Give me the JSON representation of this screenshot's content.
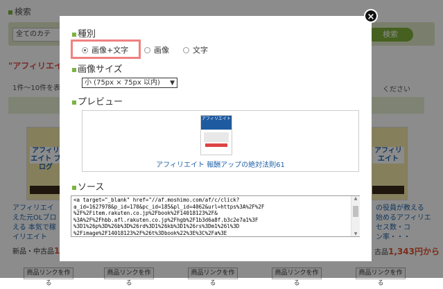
{
  "background": {
    "search_label": "検索",
    "category_select": "全てのカテ",
    "search_button": "検索",
    "heading": "\"アフィリエイ",
    "count": "1件〜10件を表",
    "right_note": "ください",
    "books": [
      {
        "title": "アフィリエイト\nブログ"
      },
      {
        "title": "アフィリエイト"
      }
    ],
    "desc_left": "アフィリエイ\nえた元OLブロ\nえる 本気で稼\nイリエイト",
    "desc_right": "の役員が教える\n始めるアフィリエ\nセス数・コ\nン率・・・",
    "price_left_prefix": "新品・中古品",
    "price_left_value": "1,",
    "price_right_prefix": "古品",
    "price_right_value": "1,343円から",
    "link_button": "商品リンクを作る"
  },
  "modal": {
    "close_icon": "×",
    "type_heading": "種別",
    "radios": [
      {
        "label": "画像+文字",
        "checked": true
      },
      {
        "label": "画像",
        "checked": false
      },
      {
        "label": "文字",
        "checked": false
      }
    ],
    "size_heading": "画像サイズ",
    "size_selected": "小 (75px × 75px 以内)",
    "preview_heading": "プレビュー",
    "preview_book_title": "アフィリエイト",
    "preview_link_text": "アフィリエイト 報酬アップの絶対法則61",
    "source_heading": "ソース",
    "source_lines": [
      "<a target=\"_blank\" href=\"//af.moshimo.com/af/c/click?",
      "a_id=1627978&p_id=170&pc_id=185&pl_id=4062&url=https%3A%2F%2F",
      "%2F%2Fitem.rakuten.co.jp%2Fbook%2F14018123%2F&",
      "%3A%2F%2Fhbb.afl.rakuten.co.jp%2Fhgb%2F1b3d6a8f.b3c2e7a1%3F",
      "%3D1%26p%3D%26b%3D%26rd%3D1%26kb%3D1%26rs%3Dm1%26l%3D",
      "%2Fimage%2F14018123%2F%26t%3Dbook%22%3E%3C%2Fa%3E"
    ]
  }
}
